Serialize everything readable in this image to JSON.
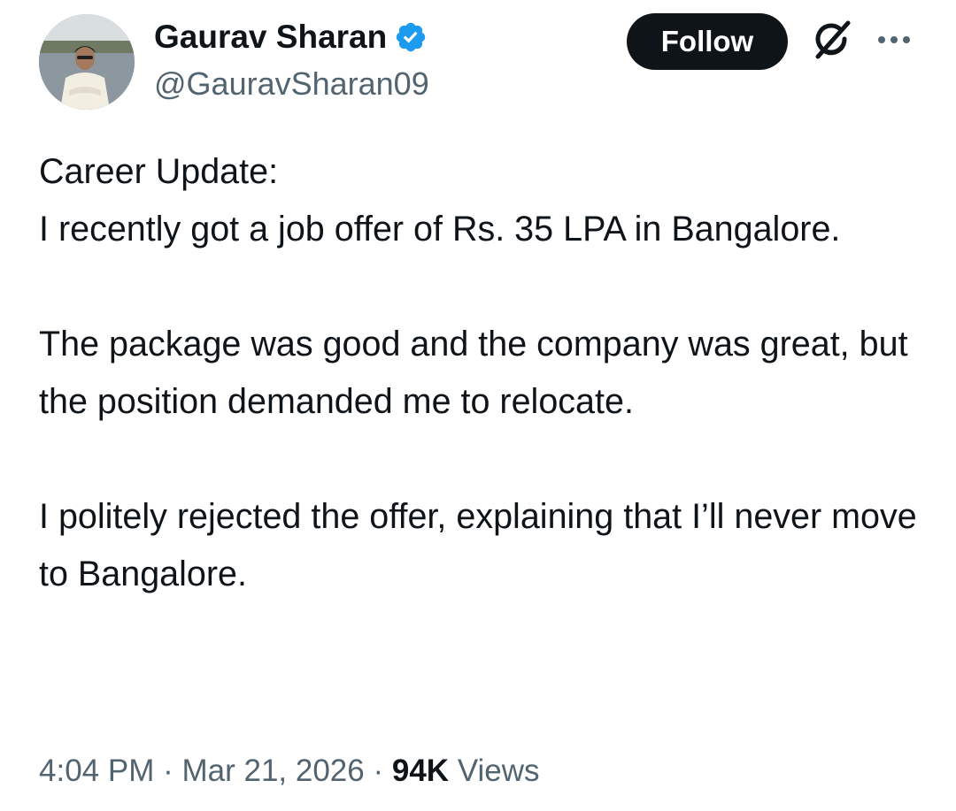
{
  "author": {
    "display_name": "Gaurav Sharan",
    "handle": "@GauravSharan09",
    "verified_icon": "verified-badge-icon",
    "verified_color": "#1d9bf0"
  },
  "actions": {
    "follow_label": "Follow",
    "grok_icon": "grok-icon",
    "more_icon": "more-icon"
  },
  "tweet": {
    "paragraphs": [
      "Career Update:\nI recently got a job offer of Rs. 35 LPA in Bangalore.",
      "The package was good and the company was great, but the position demanded me to relocate.",
      "I politely rejected the offer, explaining that I’ll never move to Bangalore."
    ]
  },
  "meta": {
    "time": "4:04 PM",
    "separator": "·",
    "date": "Mar 21, 2026",
    "views_count": "94K",
    "views_label": "Views"
  },
  "colors": {
    "text_primary": "#0f1419",
    "text_secondary": "#536471",
    "follow_bg": "#0f1419",
    "follow_text": "#ffffff"
  }
}
